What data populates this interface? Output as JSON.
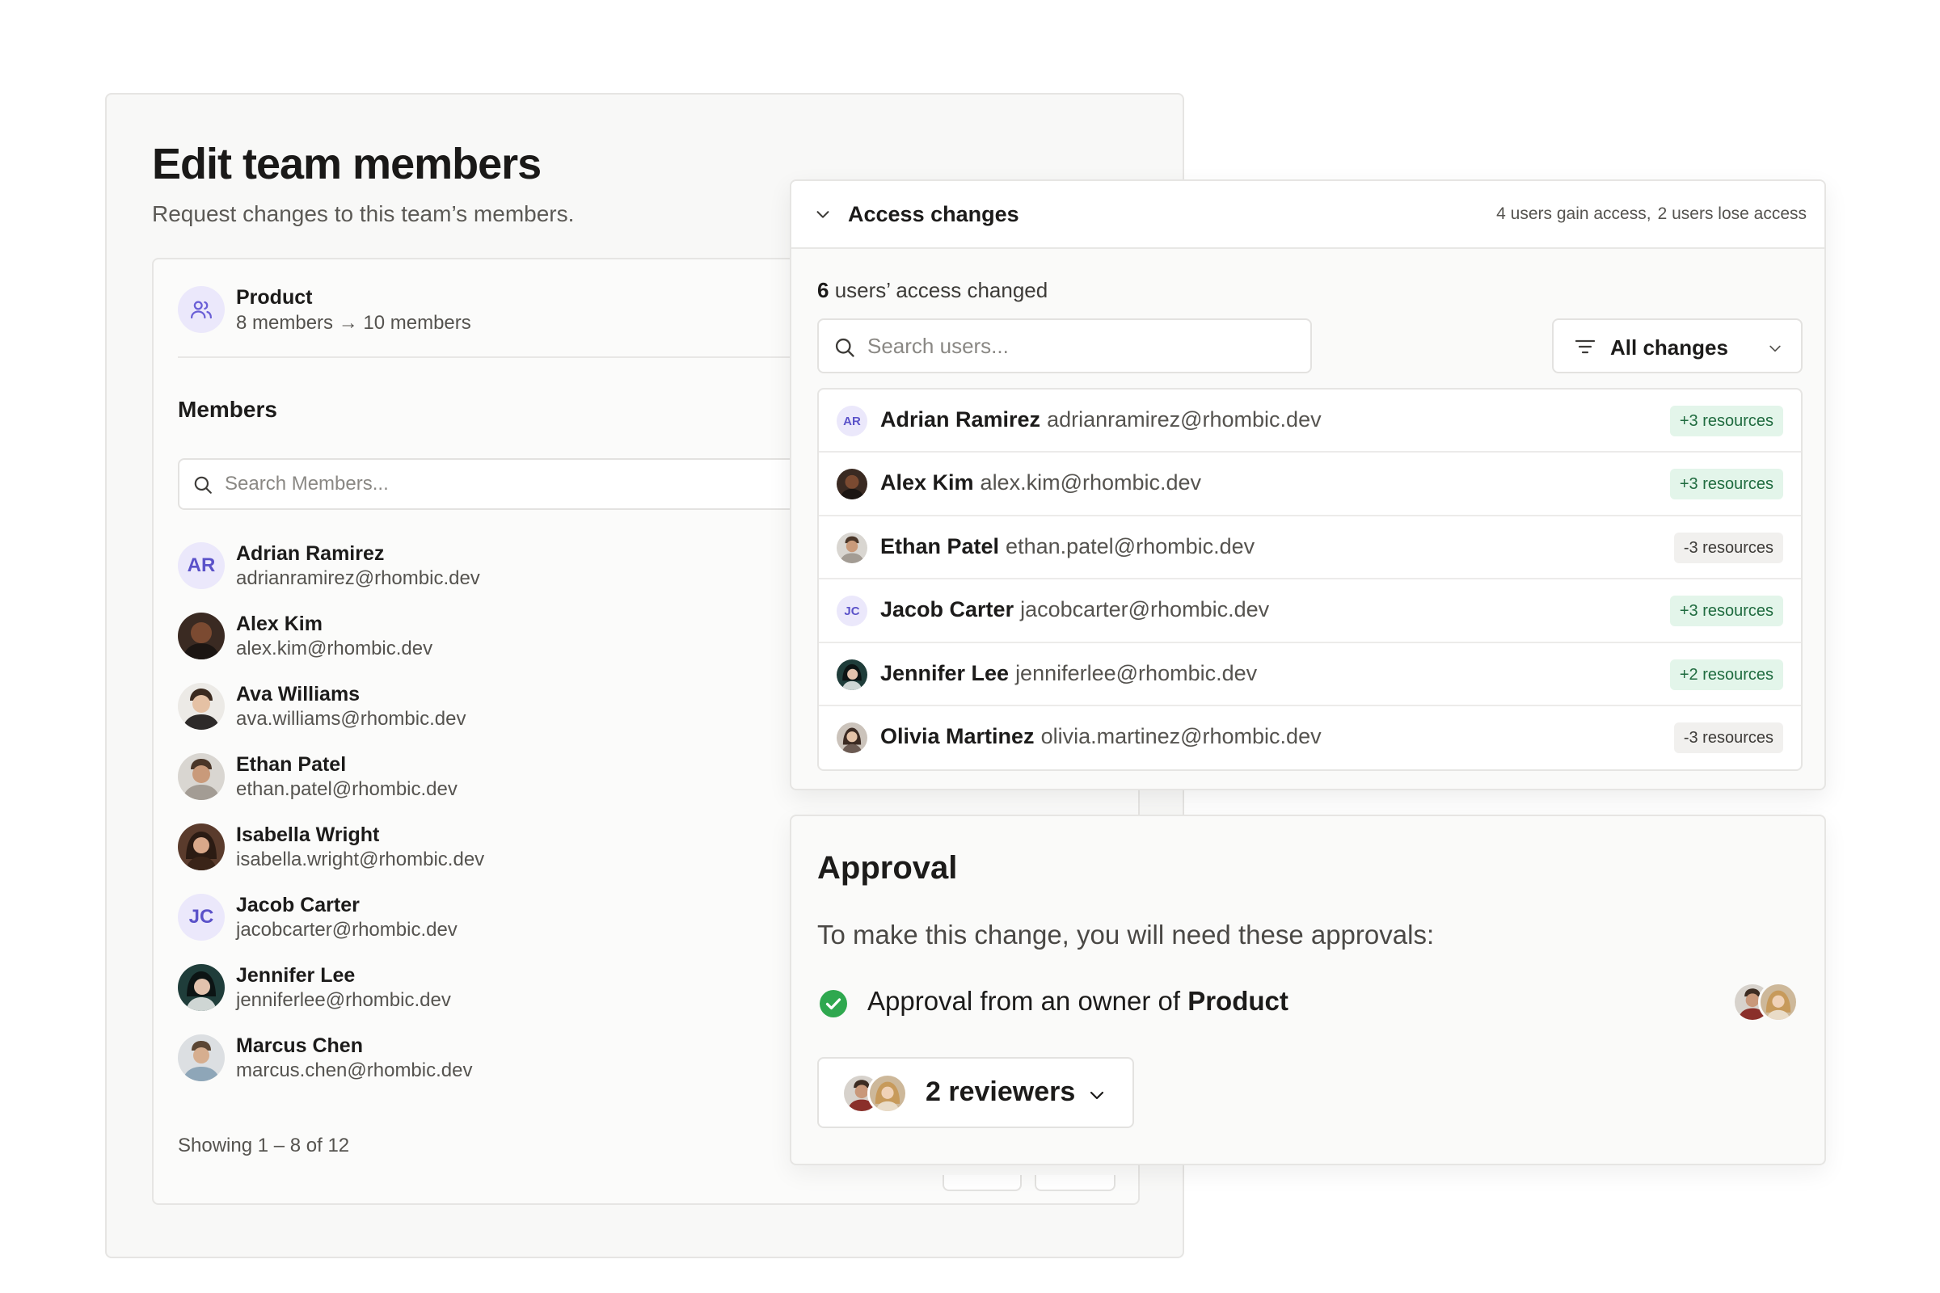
{
  "page": {
    "title": "Edit team members",
    "subtitle": "Request changes to this team’s members."
  },
  "team": {
    "icon": "users-icon",
    "name": "Product",
    "member_change": "8 members → 10 members"
  },
  "members": {
    "heading": "Members",
    "search_placeholder": "Search Members...",
    "list": [
      {
        "name": "Adrian Ramirez",
        "email": "adrianramirez@rhombic.dev",
        "initials": "AR"
      },
      {
        "name": "Alex Kim",
        "email": "alex.kim@rhombic.dev"
      },
      {
        "name": "Ava Williams",
        "email": "ava.williams@rhombic.dev"
      },
      {
        "name": "Ethan Patel",
        "email": "ethan.patel@rhombic.dev"
      },
      {
        "name": "Isabella Wright",
        "email": "isabella.wright@rhombic.dev"
      },
      {
        "name": "Jacob Carter",
        "email": "jacobcarter@rhombic.dev",
        "initials": "JC"
      },
      {
        "name": "Jennifer Lee",
        "email": "jenniferlee@rhombic.dev"
      },
      {
        "name": "Marcus Chen",
        "email": "marcus.chen@rhombic.dev"
      }
    ],
    "pagination": "Showing 1 – 8 of 12"
  },
  "access": {
    "title": "Access changes",
    "gain_summary": "4 users gain access,",
    "lose_summary": "2 users lose access",
    "changed_count": "6",
    "changed_suffix": "users’ access changed",
    "search_placeholder": "Search users...",
    "filter_label": "All changes",
    "rows": [
      {
        "name": "Adrian Ramirez",
        "email": "adrianramirez@rhombic.dev",
        "initials": "AR",
        "resources": "+3 resources"
      },
      {
        "name": "Alex Kim",
        "email": "alex.kim@rhombic.dev",
        "resources": "+3 resources"
      },
      {
        "name": "Ethan Patel",
        "email": "ethan.patel@rhombic.dev",
        "resources": "-3 resources"
      },
      {
        "name": "Jacob Carter",
        "email": "jacobcarter@rhombic.dev",
        "initials": "JC",
        "resources": "+3 resources"
      },
      {
        "name": "Jennifer Lee",
        "email": "jenniferlee@rhombic.dev",
        "resources": "+2 resources"
      },
      {
        "name": "Olivia Martinez",
        "email": "olivia.martinez@rhombic.dev",
        "resources": "-3 resources"
      }
    ]
  },
  "approval": {
    "title": "Approval",
    "description": "To make this change, you will need these approvals:",
    "requirement_prefix": "Approval from an owner of",
    "requirement_team": "Product",
    "reviewers_label": "2 reviewers"
  },
  "colors": {
    "accent_purple": "#5b52c9",
    "gain_badge_bg": "#e3f5ea",
    "gain_badge_text": "#1f6b3f",
    "lose_badge_bg": "#f1f0ee",
    "success_green": "#2fa84f"
  }
}
